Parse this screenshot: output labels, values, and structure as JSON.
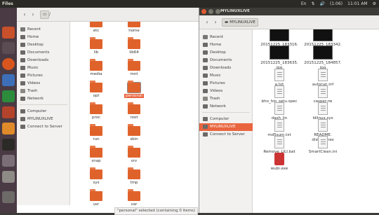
{
  "topbar": {
    "app_name": "Files",
    "indicators": [
      "En",
      "(1:06)",
      "11:01 AM"
    ]
  },
  "window_left": {
    "path": "/",
    "sidebar": [
      {
        "label": "Recent"
      },
      {
        "label": "Home"
      },
      {
        "label": "Desktop"
      },
      {
        "label": "Documents"
      },
      {
        "label": "Downloads"
      },
      {
        "label": "Music"
      },
      {
        "label": "Pictures"
      },
      {
        "label": "Videos"
      },
      {
        "label": "Trash"
      },
      {
        "label": "Network"
      },
      {
        "label": "Computer"
      },
      {
        "label": "MYLINUXLIVE"
      },
      {
        "label": "Connect to Server"
      }
    ],
    "files": [
      {
        "name": "etc"
      },
      {
        "name": "home"
      },
      {
        "name": "lib"
      },
      {
        "name": "lib64"
      },
      {
        "name": "media"
      },
      {
        "name": "mnt"
      },
      {
        "name": "opt"
      },
      {
        "name": "personal"
      },
      {
        "name": "proc"
      },
      {
        "name": "root"
      },
      {
        "name": "run"
      },
      {
        "name": "sbin"
      },
      {
        "name": "snap"
      },
      {
        "name": "srv"
      },
      {
        "name": "sys"
      },
      {
        "name": "tmp"
      },
      {
        "name": "usr"
      },
      {
        "name": "var"
      }
    ],
    "status": "\"personal\" selected  (containing 0 items)"
  },
  "window_right": {
    "title": "MYLINUXLIVE",
    "path": "MYLINUXLIVE",
    "sidebar": [
      {
        "label": "Recent"
      },
      {
        "label": "Home"
      },
      {
        "label": "Desktop"
      },
      {
        "label": "Documents"
      },
      {
        "label": "Downloads"
      },
      {
        "label": "Music"
      },
      {
        "label": "Pictures"
      },
      {
        "label": "Videos"
      },
      {
        "label": "Trash"
      },
      {
        "label": "Network"
      },
      {
        "label": "Computer"
      },
      {
        "label": "MYLINUXLIVE"
      },
      {
        "label": "Connect to Server"
      }
    ],
    "files": [
      {
        "name": "20151225_183316.\njpg",
        "kind": "thumb"
      },
      {
        "name": "20151225_183342.\njpg",
        "kind": "thumb"
      },
      {
        "name": "20151225_183635.\njpg",
        "kind": "thumb"
      },
      {
        "name": "20151225_184857.\njpg",
        "kind": "thumb"
      },
      {
        "name": "a.txt",
        "kind": "doc"
      },
      {
        "name": "autorun.inf",
        "kind": "doc"
      },
      {
        "name": "bho_hin_setu.spec",
        "kind": "doc"
      },
      {
        "name": "casper-rw",
        "kind": "doc"
      },
      {
        "name": "dash_lin",
        "kind": "doc"
      },
      {
        "name": "ldlinux.sys",
        "kind": "doc"
      },
      {
        "name": "md5sum.txt",
        "kind": "doc"
      },
      {
        "name": "README.\ndiskdefines",
        "kind": "doc"
      },
      {
        "name": "Remove_LILI.bat",
        "kind": "doc"
      },
      {
        "name": "SmartClean.ini",
        "kind": "doc"
      },
      {
        "name": "wubi.exe",
        "kind": "exe"
      }
    ]
  },
  "colors": {
    "accent": "#e9653f",
    "folder": "#e0622b",
    "launcher": "#4a3a44",
    "panel": "#2b2a27"
  }
}
